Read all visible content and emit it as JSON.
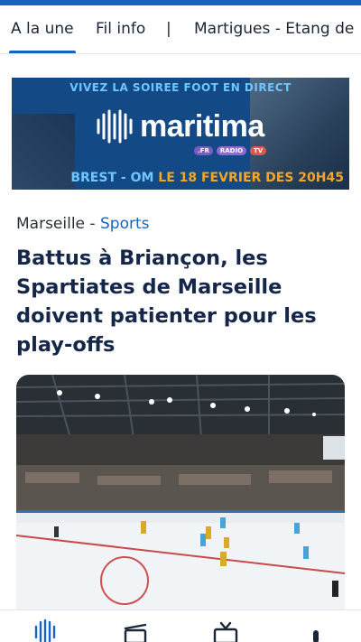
{
  "tabs": [
    {
      "label": "A la une",
      "active": true
    },
    {
      "label": "Fil info",
      "active": false
    },
    {
      "label": "Martigues - Etang de",
      "active": false
    }
  ],
  "tab_separator": "|",
  "banner": {
    "top_text": "VIVEZ LA SOIREE FOOT EN DIRECT",
    "brand": "maritima",
    "chips": [
      ".FR",
      "RADIO",
      "TV"
    ],
    "bottom_text_1": "BREST - OM",
    "bottom_text_2": " LE 18 FEVRIER DES 20H45"
  },
  "article": {
    "city": "Marseille",
    "separator": " - ",
    "section": "Sports",
    "headline": "Battus à Briançon, les Spartiates de Marseille doivent patienter pour les play-offs"
  },
  "bottom_nav": [
    "home-logo-icon",
    "radio-icon",
    "tv-icon",
    "microphone-icon"
  ],
  "colors": {
    "accent": "#1565c0",
    "headline": "#14264a",
    "banner_bg": "#134a86",
    "banner_orange": "#f5a623"
  }
}
